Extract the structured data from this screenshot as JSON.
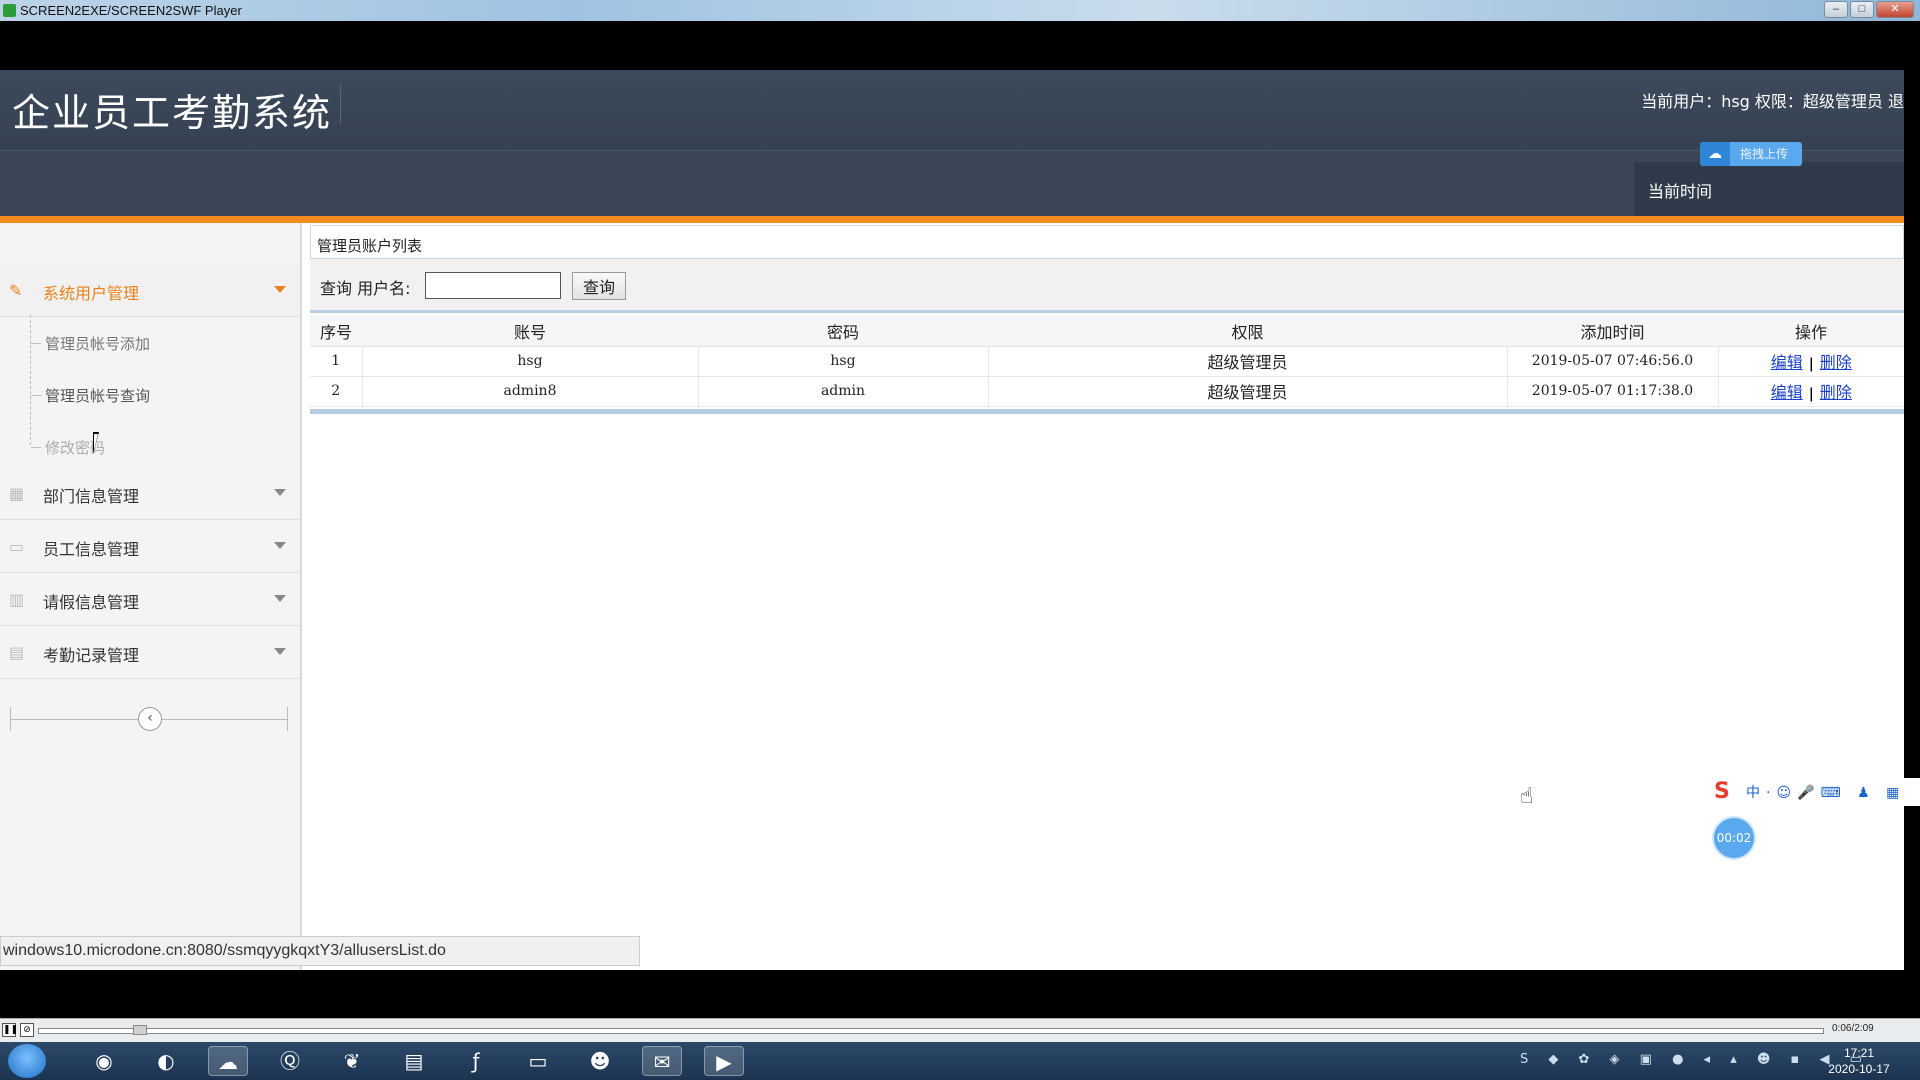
{
  "window": {
    "title": "SCREEN2EXE/SCREEN2SWF Player"
  },
  "header": {
    "system_title": "企业员工考勤系统",
    "user_info": "当前用户：hsg 权限：超级管理员 退",
    "time_label": "当前时间",
    "upload_label": "拖拽上传"
  },
  "sidebar": {
    "groups": [
      {
        "label": "系统用户管理",
        "icon": "pencil-icon"
      },
      {
        "label": "部门信息管理",
        "icon": "grid-icon"
      },
      {
        "label": "员工信息管理",
        "icon": "monitor-icon"
      },
      {
        "label": "请假信息管理",
        "icon": "layout-icon"
      },
      {
        "label": "考勤记录管理",
        "icon": "calendar-icon"
      }
    ],
    "subitems": [
      {
        "label": "管理员帐号添加"
      },
      {
        "label": "管理员帐号查询"
      },
      {
        "label": "修改密码"
      }
    ],
    "collapse_glyph": "‹"
  },
  "content": {
    "panel_title": "管理员账户列表",
    "search": {
      "label": "查询 用户名:",
      "value": "",
      "button": "查询"
    },
    "table": {
      "columns": [
        "序号",
        "账号",
        "密码",
        "权限",
        "添加时间",
        "操作"
      ],
      "rows": [
        {
          "no": "1",
          "account": "hsg",
          "password": "hsg",
          "role": "超级管理员",
          "time": "2019-05-07 07:46:56.0",
          "edit": "编辑",
          "delete": "删除"
        },
        {
          "no": "2",
          "account": "admin8",
          "password": "admin",
          "role": "超级管理员",
          "time": "2019-05-07 01:17:38.0",
          "edit": "编辑",
          "delete": "删除"
        }
      ],
      "op_separator": "|"
    }
  },
  "statusbar": {
    "url": "windows10.microdone.cn:8080/ssmqyygkqxtY3/allusersList.do"
  },
  "ime": {
    "logo": "S",
    "tools": "中·☺🎤⌨ ♟ ▦"
  },
  "recorder": {
    "timer": "00:02"
  },
  "player": {
    "time": "0:06/2:09"
  },
  "taskbar": {
    "clock_time": "17:21",
    "clock_date": "2020-10-17"
  },
  "colors": {
    "accent": "#f28a1e",
    "header": "#3d4a5c",
    "link": "#1a3fc7"
  }
}
